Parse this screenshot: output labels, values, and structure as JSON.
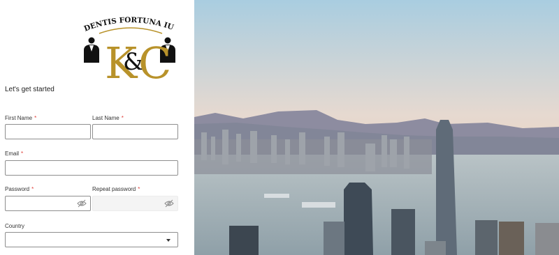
{
  "logo": {
    "motto": "AUDENTIS FORTUNA IUVAT",
    "monogram_k": "K",
    "monogram_amp": "&",
    "monogram_c": "C",
    "gold": "#b8922a"
  },
  "form": {
    "heading": "Let's get started",
    "required_mark": "*",
    "first_name": {
      "label": "First Name",
      "value": ""
    },
    "last_name": {
      "label": "Last Name",
      "value": ""
    },
    "email": {
      "label": "Email",
      "value": ""
    },
    "password": {
      "label": "Password",
      "value": "",
      "icon": "eye-off-icon"
    },
    "repeat_password": {
      "label": "Repeat password",
      "value": "",
      "icon": "eye-off-icon"
    },
    "country": {
      "label": "Country",
      "selected": "",
      "icon": "chevron-down-icon"
    }
  },
  "colors": {
    "required": "#e0403a",
    "border": "#8e8e8e",
    "sky_top": "#a9cde0",
    "sky_bottom": "#f2c9a4"
  }
}
